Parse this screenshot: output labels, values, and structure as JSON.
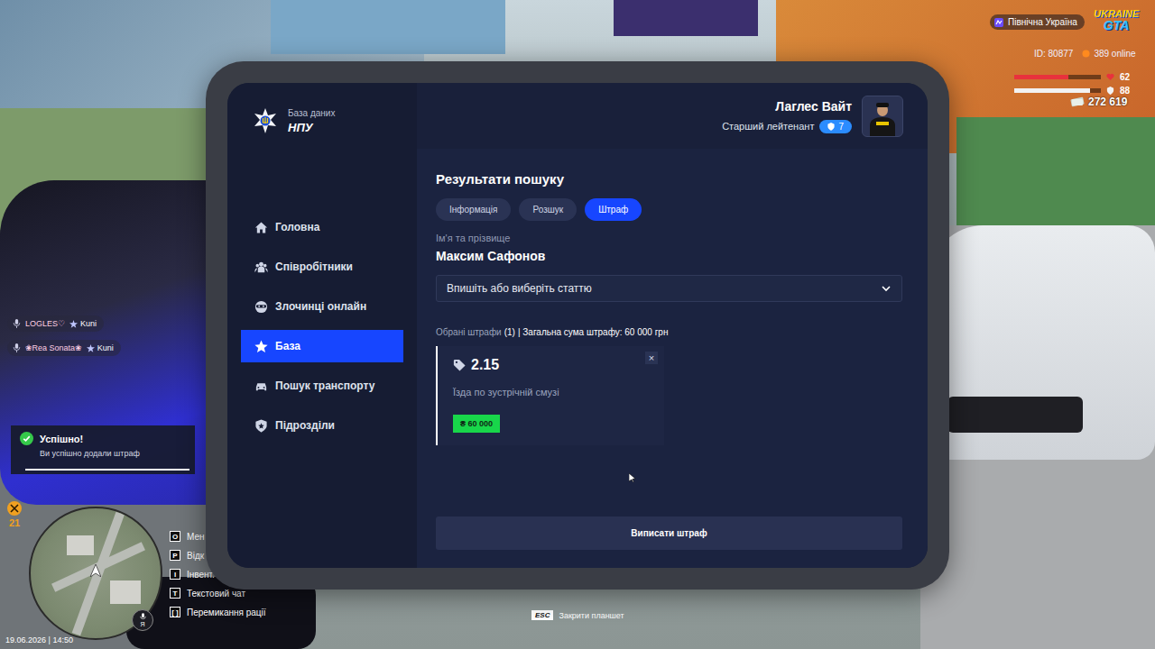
{
  "hud": {
    "server": "Північна Україна",
    "logo": {
      "line1": "UKRAINE",
      "line2": "GTA"
    },
    "id": "ID: 80877",
    "online": "389 online",
    "health": {
      "value": "62",
      "level": 0.62
    },
    "armor": {
      "value": "88",
      "level": 0.88
    },
    "money": "272 619"
  },
  "voice_list": [
    {
      "name": "LOGLES♡",
      "tag": "Kuni"
    },
    {
      "name": "❀Rea Sonata❀",
      "tag": "Kuni"
    }
  ],
  "notification": {
    "title": "Успішно!",
    "message": "Ви успішно додали штраф",
    "level": 1
  },
  "minimap": {
    "badge": "21",
    "voice_key": "Я"
  },
  "hotkeys": [
    {
      "key": "O",
      "label": "Мен"
    },
    {
      "key": "P",
      "label": "Відк"
    },
    {
      "key": "I",
      "label": "Інвент."
    },
    {
      "key": "T",
      "label": "Текстовий чат"
    },
    {
      "key": "[ ]",
      "label": "Перемикання рації"
    }
  ],
  "clock": "19.06.2026 | 14:50",
  "esc_hint": {
    "key": "ESC",
    "label": "Закрити планшет"
  },
  "tablet": {
    "app": {
      "subtitle": "База даних",
      "title": "НПУ"
    },
    "user": {
      "name": "Лаглес Вайт",
      "rank": "Старший лейтенант",
      "level": "7"
    },
    "sidebar": [
      {
        "label": "Головна",
        "selected": false
      },
      {
        "label": "Співробітники",
        "selected": false
      },
      {
        "label": "Злочинці онлайн",
        "selected": false
      },
      {
        "label": "База",
        "selected": true
      },
      {
        "label": "Пошук транспорту",
        "selected": false
      },
      {
        "label": "Підрозділи",
        "selected": false
      }
    ],
    "page_title": "Результати пошуку",
    "tabs": [
      {
        "label": "Інформація",
        "selected": false
      },
      {
        "label": "Розшук",
        "selected": false
      },
      {
        "label": "Штраф",
        "selected": true
      }
    ],
    "person": {
      "label": "Ім'я та прізвище",
      "name": "Максим Сафонов"
    },
    "article_select": {
      "placeholder": "Впишіть або виберіть статтю"
    },
    "summary": {
      "label": "Обрані штрафи",
      "count": "(1)",
      "total": "| Загальна сума штрафу: 60 000 грн"
    },
    "fines": [
      {
        "code": "2.15",
        "description": "Їзда по зустрічній смузі",
        "amount": "₴ 60 000",
        "remove": "×"
      }
    ],
    "submit": "Виписати штраф"
  }
}
